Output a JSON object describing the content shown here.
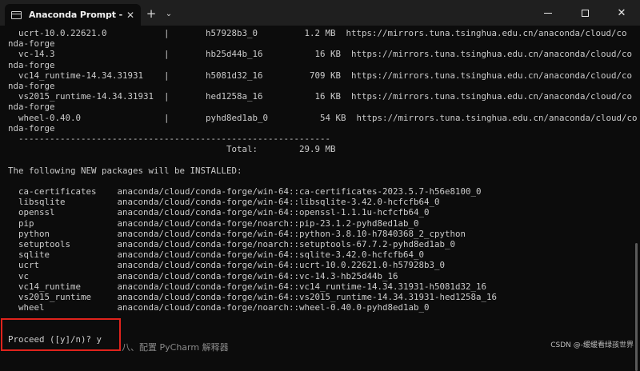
{
  "window": {
    "tab_title": "Anaconda Prompt - conda  cr",
    "tab_close": "✕",
    "new_tab": "+",
    "dropdown": "⌄",
    "close": "✕"
  },
  "terminal": {
    "lines": [
      "  ucrt-10.0.22621.0           |       h57928b3_0         1.2 MB  https://mirrors.tuna.tsinghua.edu.cn/anaconda/cloud/co",
      "nda-forge",
      "  vc-14.3                     |       hb25d44b_16          16 KB  https://mirrors.tuna.tsinghua.edu.cn/anaconda/cloud/co",
      "nda-forge",
      "  vc14_runtime-14.34.31931    |       h5081d32_16         709 KB  https://mirrors.tuna.tsinghua.edu.cn/anaconda/cloud/co",
      "nda-forge",
      "  vs2015_runtime-14.34.31931  |       hed1258a_16          16 KB  https://mirrors.tuna.tsinghua.edu.cn/anaconda/cloud/co",
      "nda-forge",
      "  wheel-0.40.0                |       pyhd8ed1ab_0          54 KB  https://mirrors.tuna.tsinghua.edu.cn/anaconda/cloud/co",
      "nda-forge",
      "  ------------------------------------------------------------",
      "                                          Total:        29.9 MB",
      "",
      "The following NEW packages will be INSTALLED:",
      "",
      "  ca-certificates    anaconda/cloud/conda-forge/win-64::ca-certificates-2023.5.7-h56e8100_0",
      "  libsqlite          anaconda/cloud/conda-forge/win-64::libsqlite-3.42.0-hcfcfb64_0",
      "  openssl            anaconda/cloud/conda-forge/win-64::openssl-1.1.1u-hcfcfb64_0",
      "  pip                anaconda/cloud/conda-forge/noarch::pip-23.1.2-pyhd8ed1ab_0",
      "  python             anaconda/cloud/conda-forge/win-64::python-3.8.10-h7840368_2_cpython",
      "  setuptools         anaconda/cloud/conda-forge/noarch::setuptools-67.7.2-pyhd8ed1ab_0",
      "  sqlite             anaconda/cloud/conda-forge/win-64::sqlite-3.42.0-hcfcfb64_0",
      "  ucrt               anaconda/cloud/conda-forge/win-64::ucrt-10.0.22621.0-h57928b3_0",
      "  vc                 anaconda/cloud/conda-forge/win-64::vc-14.3-hb25d44b_16",
      "  vc14_runtime       anaconda/cloud/conda-forge/win-64::vc14_runtime-14.34.31931-h5081d32_16",
      "  vs2015_runtime     anaconda/cloud/conda-forge/win-64::vs2015_runtime-14.34.31931-hed1258a_16",
      "  wheel              anaconda/cloud/conda-forge/noarch::wheel-0.40.0-pyhd8ed1ab_0",
      "",
      "",
      "Proceed ([y]/n)? y"
    ]
  },
  "overlay": {
    "under_text": "八、配置 PyCharm 解释器",
    "watermark": "CSDN @-缓缓看绿孩世界",
    "highlight_color": "#e0231c"
  }
}
